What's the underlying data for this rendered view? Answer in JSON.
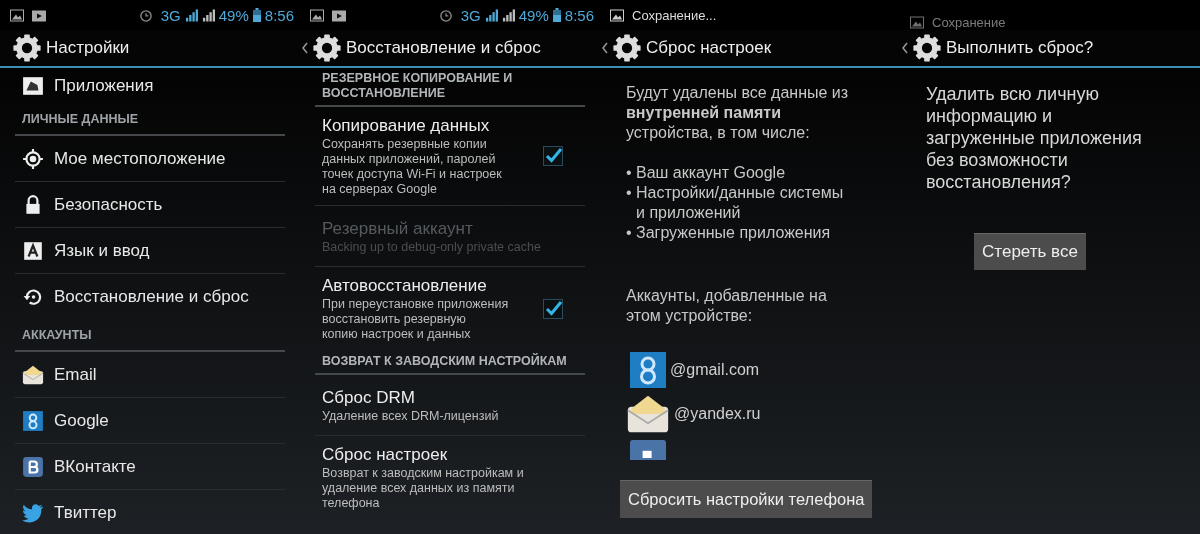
{
  "panels": [
    {
      "kind": "settings",
      "status_bar": {
        "kind": "icons",
        "network": "3G",
        "battery": "49%",
        "time": "8:56"
      },
      "action_bar": {
        "title": "Настройки",
        "has_back": false
      },
      "list": [
        {
          "kind": "item",
          "label": "Приложения"
        },
        {
          "kind": "header",
          "label": "ЛИЧНЫЕ ДАННЫЕ"
        },
        {
          "kind": "item",
          "label": "Мое местоположение"
        },
        {
          "kind": "item",
          "label": "Безопасность"
        },
        {
          "kind": "item",
          "label": "Язык и ввод"
        },
        {
          "kind": "item",
          "label": "Восстановление и сброс"
        },
        {
          "kind": "header",
          "label": "АККАУНТЫ"
        },
        {
          "kind": "item",
          "label": "Email"
        },
        {
          "kind": "item",
          "label": "Google"
        },
        {
          "kind": "item",
          "label": "ВКонтакте"
        },
        {
          "kind": "item",
          "label": "Твиттер"
        }
      ]
    },
    {
      "kind": "backup",
      "status_bar": {
        "kind": "icons",
        "network": "3G",
        "battery": "49%",
        "time": "8:56"
      },
      "action_bar": {
        "title": "Восстановление и сброс",
        "has_back": true
      },
      "list": [
        {
          "kind": "header",
          "label": "РЕЗЕРВНОЕ КОПИРОВАНИЕ И\nВОССТАНОВЛЕНИЕ"
        },
        {
          "kind": "checkbox",
          "title": "Копирование данных",
          "summary": "Сохранять резервные копии\nданных приложений, паролей\nточек доступа Wi-Fi и настроек\nна серверах Google",
          "checked": true,
          "disabled": false
        },
        {
          "kind": "plain",
          "title": "Резервный аккаунт",
          "summary": "Backing up to debug-only private cache",
          "disabled": true
        },
        {
          "kind": "checkbox",
          "title": "Автовосстановление",
          "summary": "При переустановке приложения\nвосстановить резервную\nкопию настроек и данных",
          "checked": true,
          "disabled": false
        },
        {
          "kind": "header",
          "label": "ВОЗВРАТ К ЗАВОДСКИМ НАСТРОЙКАМ"
        },
        {
          "kind": "plain",
          "title": "Сброс DRM",
          "summary": "Удаление всех DRM-лицензий",
          "disabled": false
        },
        {
          "kind": "plain",
          "title": "Сброс настроек",
          "summary": "Возврат к заводским настройкам и\nудаление всех данных из памяти\nтелефона",
          "disabled": false
        }
      ]
    },
    {
      "kind": "reset-info",
      "status_bar": {
        "kind": "notification",
        "text": "Сохранение...",
        "faded": false
      },
      "action_bar": {
        "title": "Сброс настроек",
        "has_back": true
      },
      "intro": "Будут удалены все данные из\n**внутренней памяти**\nустройства, в том числе:",
      "bullets": [
        {
          "bullet": "•",
          "text": "Ваш аккаунт Google"
        },
        {
          "bullet": "•",
          "text": "Настройки/данные системы\nи приложений"
        },
        {
          "bullet": "•",
          "text": "Загруженные приложения"
        }
      ],
      "accounts_heading": "Аккаунты, добавленные на\nэтом устройстве:",
      "accounts": [
        {
          "label": "@gmail.com"
        },
        {
          "label": "@yandex.ru"
        }
      ],
      "button": "Сбросить настройки телефона"
    },
    {
      "kind": "confirm",
      "status_bar": {
        "kind": "notification",
        "text": "Сохранение",
        "faded": true
      },
      "action_bar": {
        "title": "Выполнить сброс?",
        "has_back": true
      },
      "message": "Удалить всю личную\nинформацию и\nзагруженные приложения\nбез возможности\nвосстановления?",
      "button": "Стереть все"
    }
  ]
}
